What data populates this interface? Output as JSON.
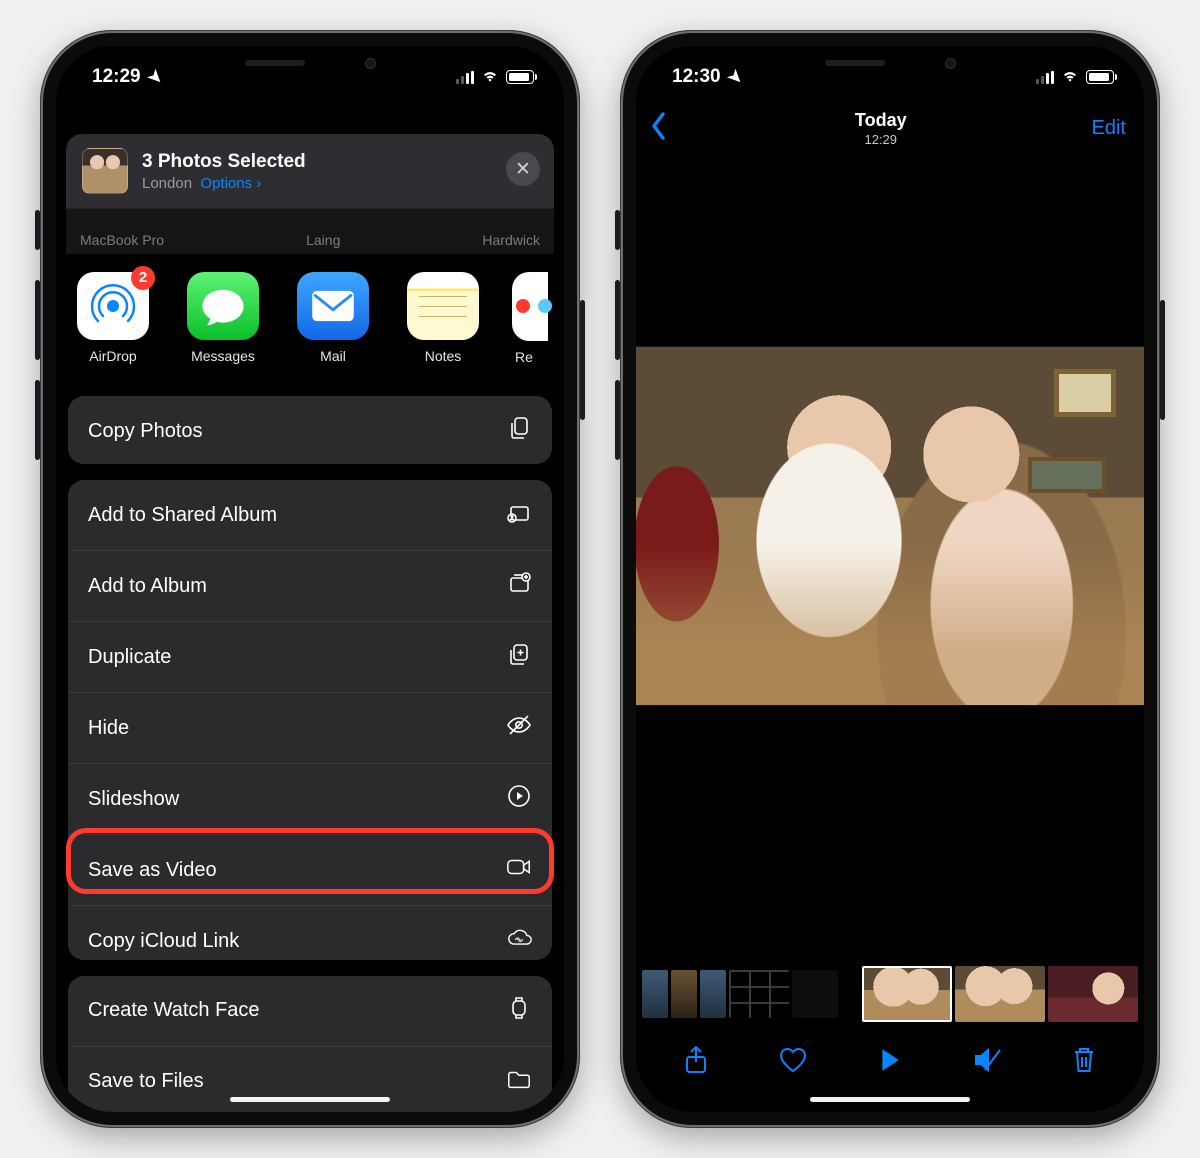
{
  "left": {
    "status_time": "12:29",
    "airdrop_targets": [
      "MacBook Pro",
      "Laing",
      "Hardwick"
    ],
    "header": {
      "title": "3 Photos Selected",
      "location": "London",
      "options_label": "Options"
    },
    "apps": [
      {
        "label": "AirDrop",
        "badge": "2"
      },
      {
        "label": "Messages"
      },
      {
        "label": "Mail"
      },
      {
        "label": "Notes"
      },
      {
        "label": "Re"
      }
    ],
    "group1": [
      {
        "label": "Copy Photos",
        "icon": "copy"
      }
    ],
    "group2": [
      {
        "label": "Add to Shared Album",
        "icon": "shared-album"
      },
      {
        "label": "Add to Album",
        "icon": "album-add"
      },
      {
        "label": "Duplicate",
        "icon": "duplicate"
      },
      {
        "label": "Hide",
        "icon": "hide"
      },
      {
        "label": "Slideshow",
        "icon": "play-circle"
      },
      {
        "label": "Save as Video",
        "icon": "video",
        "highlight": true
      },
      {
        "label": "Copy iCloud Link",
        "icon": "cloud-link"
      }
    ],
    "group3": [
      {
        "label": "Create Watch Face",
        "icon": "watch"
      },
      {
        "label": "Save to Files",
        "icon": "folder"
      }
    ]
  },
  "right": {
    "status_time": "12:30",
    "nav_title": "Today",
    "nav_subtitle": "12:29",
    "edit_label": "Edit"
  }
}
